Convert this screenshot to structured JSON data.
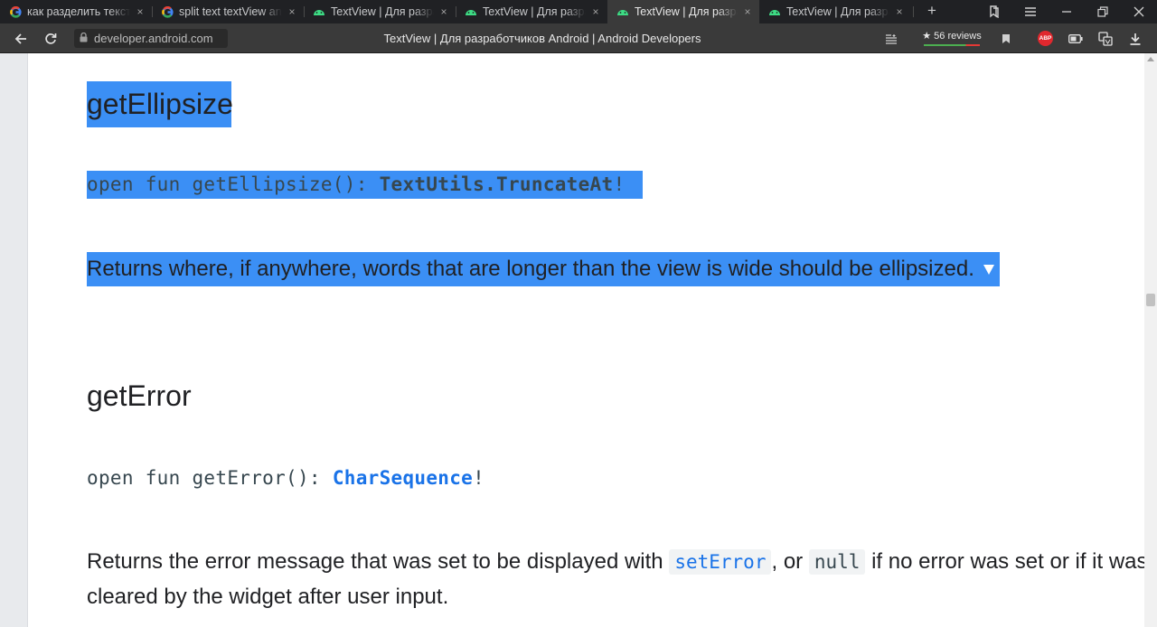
{
  "tabs": [
    {
      "title": "как разделить текст на",
      "icon": "google-icon",
      "active": false
    },
    {
      "title": "split text textView android",
      "icon": "google-icon",
      "active": false
    },
    {
      "title": "TextView | Для разработчиков",
      "icon": "android-icon",
      "active": false
    },
    {
      "title": "TextView | Для разработчиков",
      "icon": "android-icon",
      "active": false
    },
    {
      "title": "TextView | Для разработчиков",
      "icon": "android-icon",
      "active": true
    },
    {
      "title": "TextView | Для разработчиков",
      "icon": "android-icon",
      "active": false
    }
  ],
  "tab_close": "×",
  "new_tab": "+",
  "address": {
    "url": "developer.android.com",
    "title": "TextView  |  Для разработчиков Android  |  Android Developers",
    "reviews": "★ 56 reviews",
    "abp": "ABP"
  },
  "colors": {
    "selection": "#3b8ff5",
    "link": "#1a73e8",
    "tab_strip": "#202124",
    "toolbar": "#3a3a3a"
  },
  "sections": {
    "ellipsize": {
      "heading": "getEllipsize",
      "sig_prefix": "open fun getEllipsize(): ",
      "sig_type": "TextUtils.TruncateAt",
      "sig_suffix": "!",
      "description": "Returns where, if anywhere, words that are longer than the view is wide should be ellipsized."
    },
    "error": {
      "heading": "getError",
      "sig_prefix": "open fun getError(): ",
      "sig_type": "CharSequence",
      "sig_suffix": "!",
      "desc_part1": "Returns the error message that was set to be displayed with ",
      "desc_code1": "setError",
      "desc_part2": ", or ",
      "desc_code2": "null",
      "desc_part3": " if no error was set or if it was",
      "desc_line2": "cleared by the widget after user input."
    }
  }
}
